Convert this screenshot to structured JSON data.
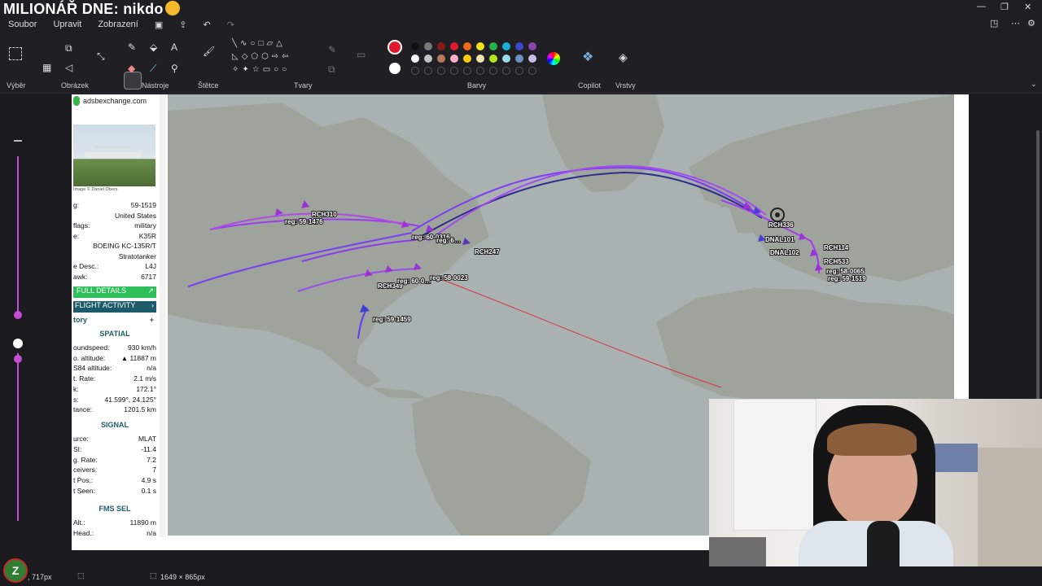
{
  "stream_title": "MILIONÁŘ DNE: nikdo",
  "menu": {
    "file": "Soubor",
    "edit": "Upravit",
    "view": "Zobrazení"
  },
  "toolbar": {
    "groups": {
      "selection": "Výběr",
      "image": "Obrázek",
      "tools": "Nástroje",
      "brushes": "Štětce",
      "shapes": "Tvary",
      "colors": "Barvy",
      "copilot": "Copilot",
      "layers": "Vrstvy"
    },
    "primary_color": "#e0192f",
    "secondary_color": "#ffffff",
    "palette_row1": [
      "#111111",
      "#7a7a7a",
      "#8a1a1a",
      "#e0192f",
      "#f26a1a",
      "#f5e31a",
      "#27b24a",
      "#1ab0d9",
      "#3f48cc",
      "#8e44ad"
    ],
    "palette_row2": [
      "#ffffff",
      "#c3c3c3",
      "#b97a57",
      "#ffaec9",
      "#ffc90e",
      "#efe4b0",
      "#b5e61d",
      "#99d9ea",
      "#7092be",
      "#c8bfe7"
    ]
  },
  "ads": {
    "site": "adsbexchange.com",
    "photo_credit": "Image © Daniel Obers",
    "rows_top": [
      {
        "label": "g:",
        "value": "59-1519"
      },
      {
        "label": "",
        "value": "United States"
      },
      {
        "label": "flags:",
        "value": "military"
      },
      {
        "label": "e:",
        "value": "K35R"
      },
      {
        "label": "",
        "value": "BOEING KC-135R/T"
      },
      {
        "label": "",
        "value": "Stratotanker"
      },
      {
        "label": "e Desc.:",
        "value": "L4J"
      },
      {
        "label": "awk:",
        "value": "6717"
      }
    ],
    "full_details": "FULL DETAILS",
    "flight_activity": "FLIGHT ACTIVITY",
    "history": "tory",
    "spatial_title": "SPATIAL",
    "spatial": [
      {
        "label": "oundspeed:",
        "value": "930 km/h"
      },
      {
        "label": "o. altitude:",
        "value": "▲ 11887 m"
      },
      {
        "label": "S84 altitude:",
        "value": "n/a"
      },
      {
        "label": "t. Rate:",
        "value": "2.1 m/s"
      },
      {
        "label": "k:",
        "value": "172.1°"
      },
      {
        "label": "s:",
        "value": "41.599°, 24.125°"
      },
      {
        "label": "tance:",
        "value": "1201.5 km"
      }
    ],
    "signal_title": "SIGNAL",
    "signal": [
      {
        "label": "urce:",
        "value": "MLAT"
      },
      {
        "label": "SI:",
        "value": "-11.4"
      },
      {
        "label": "g. Rate:",
        "value": "7.2"
      },
      {
        "label": "ceivers:",
        "value": "7"
      },
      {
        "label": "t Pos.:",
        "value": "4.9 s"
      },
      {
        "label": "t Seen:",
        "value": "0.1 s"
      }
    ],
    "fms_title": "FMS SEL",
    "fms": [
      {
        "label": "Alt.:",
        "value": "11890 m"
      },
      {
        "label": "Head.:",
        "value": "n/a"
      }
    ]
  },
  "map_labels": {
    "rch310": "RCH310",
    "reg_1476": "reg: 59-1476",
    "reg_0316": "reg: 60-0316",
    "reg_6x": "reg: 6…",
    "rch247": "RCH247",
    "rch349": "RCH349",
    "reg_60": "reg: 60-0…",
    "reg_0023": "reg: 58-0023",
    "reg_1459": "reg: 59-1459",
    "rch336": "RCH336",
    "dnal101": "DNAL101",
    "dnal102": "DNAL102",
    "rch114": "RCH114",
    "rch533": "RCH533",
    "reg_0065": "reg: 58-0065",
    "reg_1519": "reg: 59-1519"
  },
  "status": {
    "position": ", 717px",
    "size": "1649 × 865px"
  }
}
